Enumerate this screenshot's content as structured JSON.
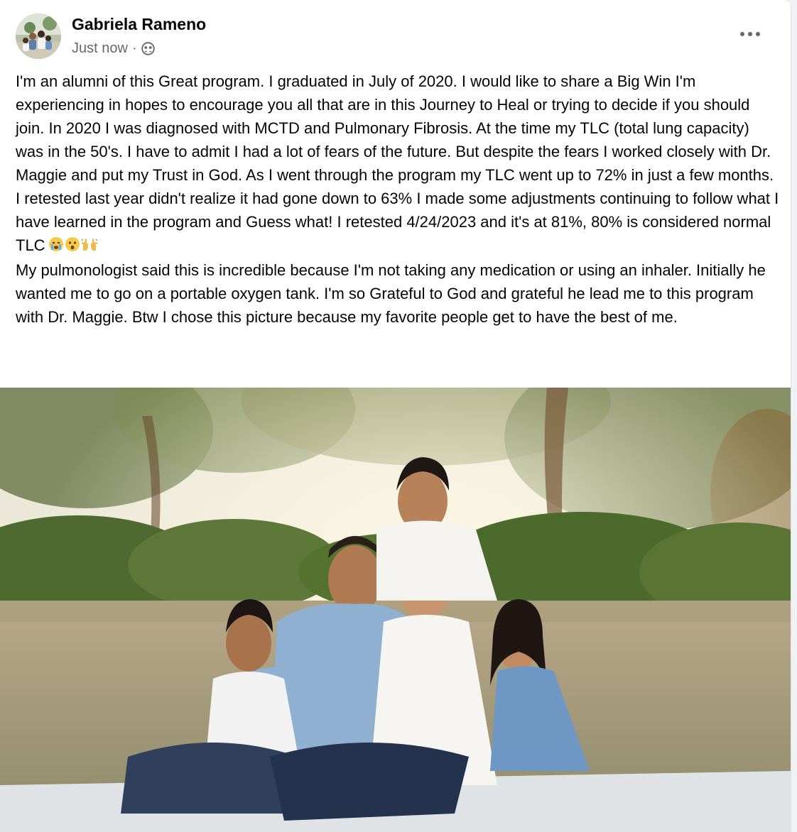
{
  "post": {
    "author": "Gabriela Rameno",
    "timestamp": "Just now",
    "separator": "·",
    "audience_icon": "friends-audience-icon",
    "more_icon": "more-options-icon",
    "paragraph_1": "I'm an alumni of this Great program. I graduated in July of 2020. I would like to share a Big Win I'm experiencing in hopes to encourage you all that are in this Journey to Heal or trying to decide if you should join. In 2020 I was diagnosed with MCTD and Pulmonary Fibrosis. At the time my TLC (total lung capacity) was in the 50's. I have to admit I had a lot of fears of the future. But despite the fears I worked closely with Dr. Maggie and put my Trust in God. As I went through the program my TLC went up to 72% in just a few months. I retested last year didn't realize it had gone down to 63% I made some adjustments continuing to follow what I have learned in the program and Guess what! I retested 4/24/2023 and it's at 81%, 80% is considered normal TLC",
    "emojis": [
      "crying-face-emoji",
      "astonished-face-emoji",
      "raising-hands-emoji"
    ],
    "paragraph_2": "My pulmonologist said this is incredible because I'm not taking any medication or using an inhaler. Initially he wanted me to go on a portable oxygen tank. I'm so Grateful to God and grateful he lead me to this program with Dr. Maggie. Btw I chose this picture because my favorite people get to have the best of me.",
    "photo": "family-photo"
  },
  "colors": {
    "text_primary": "#050505",
    "text_secondary": "#65676b",
    "card_background": "#ffffff"
  }
}
